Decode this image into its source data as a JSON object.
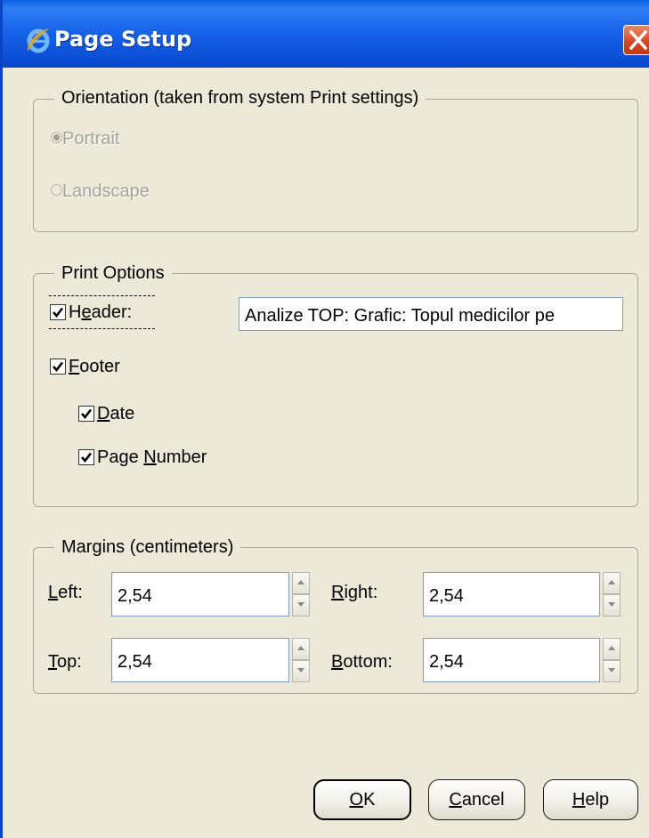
{
  "window": {
    "title": "Page Setup"
  },
  "orientation": {
    "legend": "Orientation (taken from system Print settings)",
    "portrait_label": "Portrait",
    "landscape_label": "Landscape",
    "selected": "Portrait"
  },
  "print_options": {
    "legend": "Print Options",
    "header": {
      "label_pre": "H",
      "label_mnemonic": "e",
      "label_post": "ader:",
      "checked": true,
      "value": "Analize TOP: Grafic: Topul medicilor pe"
    },
    "footer": {
      "label_mnemonic": "F",
      "label_post": "ooter",
      "checked": true
    },
    "date": {
      "label_mnemonic": "D",
      "label_post": "ate",
      "checked": true
    },
    "page_number": {
      "label_pre": "Page ",
      "label_mnemonic": "N",
      "label_post": "umber",
      "checked": true
    }
  },
  "margins": {
    "legend": "Margins (centimeters)",
    "left": {
      "label_mnemonic": "L",
      "label_post": "eft:",
      "value": "2,54"
    },
    "right": {
      "label_mnemonic": "R",
      "label_post": "ight:",
      "value": "2,54"
    },
    "top": {
      "label_mnemonic": "T",
      "label_post": "op:",
      "value": "2,54"
    },
    "bottom": {
      "label_mnemonic": "B",
      "label_post": "ottom:",
      "value": "2,54"
    }
  },
  "buttons": {
    "ok": {
      "mnemonic": "O",
      "post": "K"
    },
    "cancel": {
      "mnemonic": "C",
      "post": "ancel"
    },
    "help": {
      "mnemonic": "H",
      "post": "elp"
    }
  },
  "colors": {
    "titlebar": "#0b52d8",
    "dialog_bg": "#ece9d8",
    "close_button": "#d34520",
    "disabled_text": "#a4a39b"
  },
  "icons": {
    "title": "internet-explorer-icon",
    "close": "close-icon"
  }
}
